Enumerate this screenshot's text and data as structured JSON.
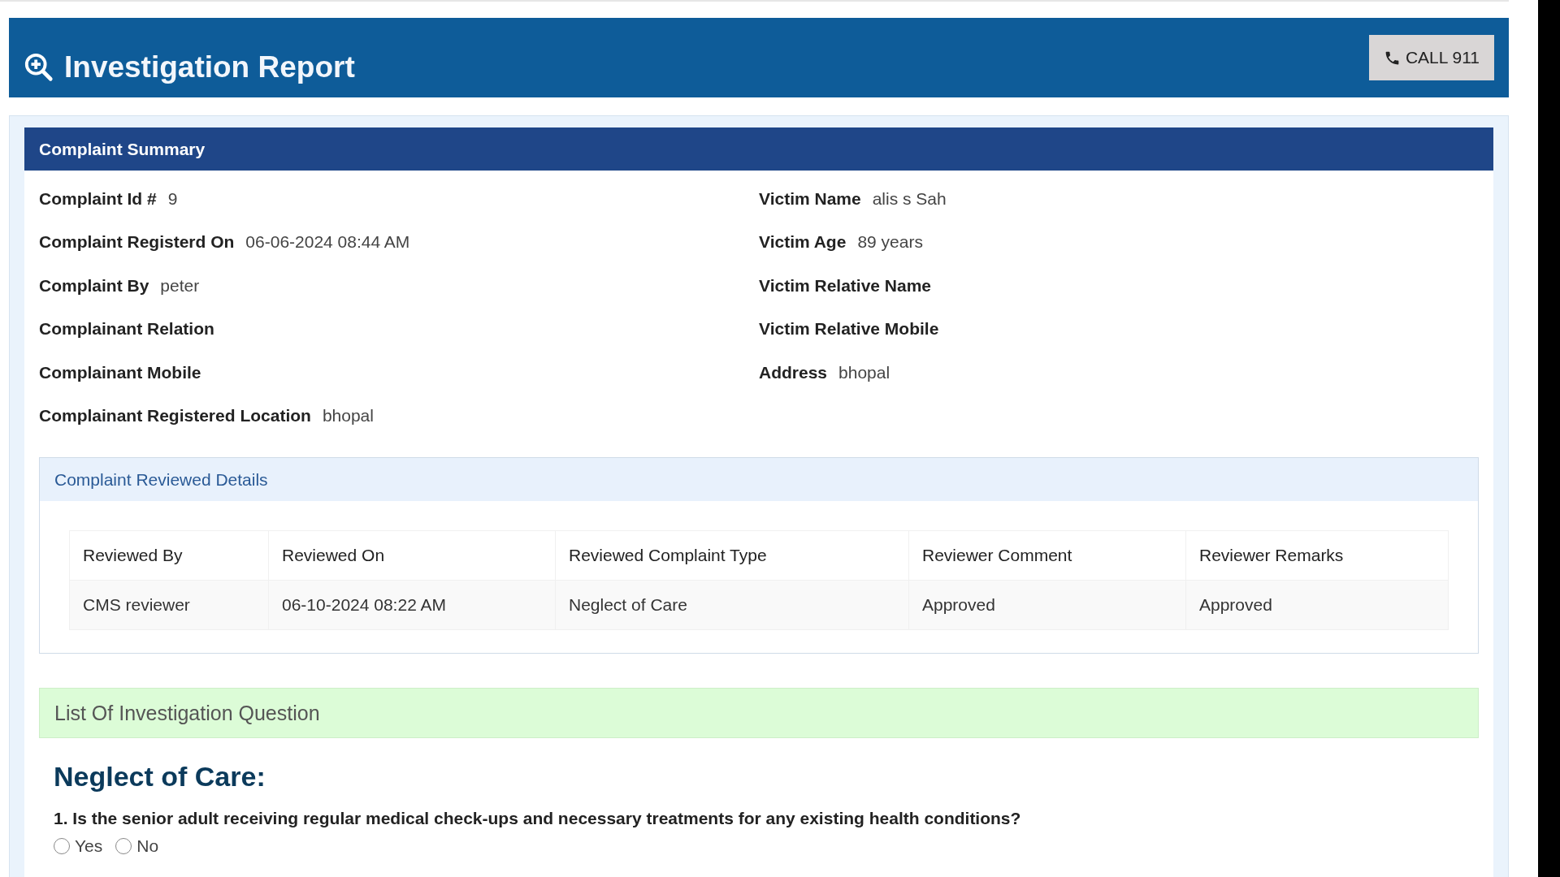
{
  "header": {
    "title": "Investigation Report",
    "call_button": "CALL 911"
  },
  "summary": {
    "title": "Complaint Summary",
    "left": [
      {
        "label": "Complaint Id #",
        "value": "9"
      },
      {
        "label": "Complaint Registerd On",
        "value": "06-06-2024 08:44 AM"
      },
      {
        "label": "Complaint By",
        "value": "peter"
      },
      {
        "label": "Complainant Relation"
      },
      {
        "label": "Complainant Mobile"
      },
      {
        "label": "Complainant Registered Location",
        "value": "bhopal"
      }
    ],
    "right": [
      {
        "label": "Victim Name",
        "value": "alis s Sah"
      },
      {
        "label": "Victim Age",
        "value": "89 years"
      },
      {
        "label": "Victim Relative Name"
      },
      {
        "label": "Victim Relative Mobile"
      },
      {
        "label": "Address",
        "value": "bhopal"
      }
    ]
  },
  "reviewed": {
    "title": "Complaint Reviewed Details",
    "table": {
      "columns": [
        "Reviewed By",
        "Reviewed On",
        "Reviewed Complaint Type",
        "Reviewer Comment",
        "Reviewer Remarks"
      ],
      "rows": [
        [
          "CMS reviewer",
          "06-10-2024 08:22 AM",
          "Neglect of Care",
          "Approved",
          "Approved"
        ]
      ]
    }
  },
  "questions": {
    "title": "List Of Investigation Question",
    "category": "Neglect of Care:",
    "items": [
      {
        "text": "1. Is the senior adult receiving regular medical check-ups and necessary treatments for any existing health conditions?",
        "options": [
          {
            "label": "Yes",
            "selected": false
          },
          {
            "label": "No",
            "selected": false
          }
        ]
      }
    ]
  }
}
